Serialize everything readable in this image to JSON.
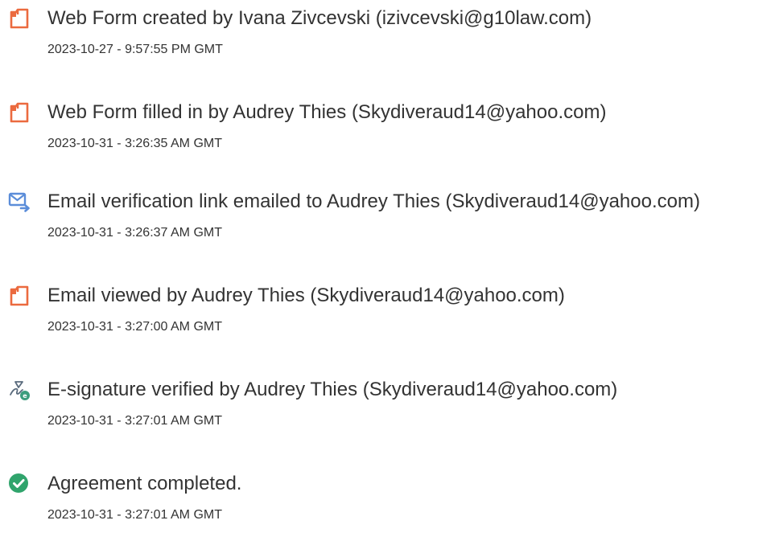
{
  "events": [
    {
      "icon": "document-icon",
      "title": "Web Form created by Ivana Zivcevski (izivcevski@g10law.com)",
      "time": "2023-10-27 - 9:57:55 PM GMT"
    },
    {
      "icon": "document-icon",
      "title": "Web Form filled in by Audrey Thies (Skydiveraud14@yahoo.com)",
      "time": "2023-10-31 - 3:26:35 AM GMT"
    },
    {
      "icon": "email-send-icon",
      "title": "Email verification link emailed to Audrey Thies (Skydiveraud14@yahoo.com)",
      "time": "2023-10-31 - 3:26:37 AM GMT"
    },
    {
      "icon": "document-icon",
      "title": "Email viewed by Audrey Thies (Skydiveraud14@yahoo.com)",
      "time": "2023-10-31 - 3:27:00 AM GMT"
    },
    {
      "icon": "signature-verified-icon",
      "title": "E-signature verified by Audrey Thies (Skydiveraud14@yahoo.com)",
      "time": "2023-10-31 - 3:27:01 AM GMT"
    },
    {
      "icon": "checkmark-circle-icon",
      "title": "Agreement completed.",
      "time": "2023-10-31 - 3:27:01 AM GMT"
    }
  ],
  "colors": {
    "document_icon": "#EB6A3F",
    "email_icon": "#5B8DD9",
    "signature_icon": "#3D9D7D",
    "check_icon": "#30A46C",
    "text": "#333333"
  }
}
